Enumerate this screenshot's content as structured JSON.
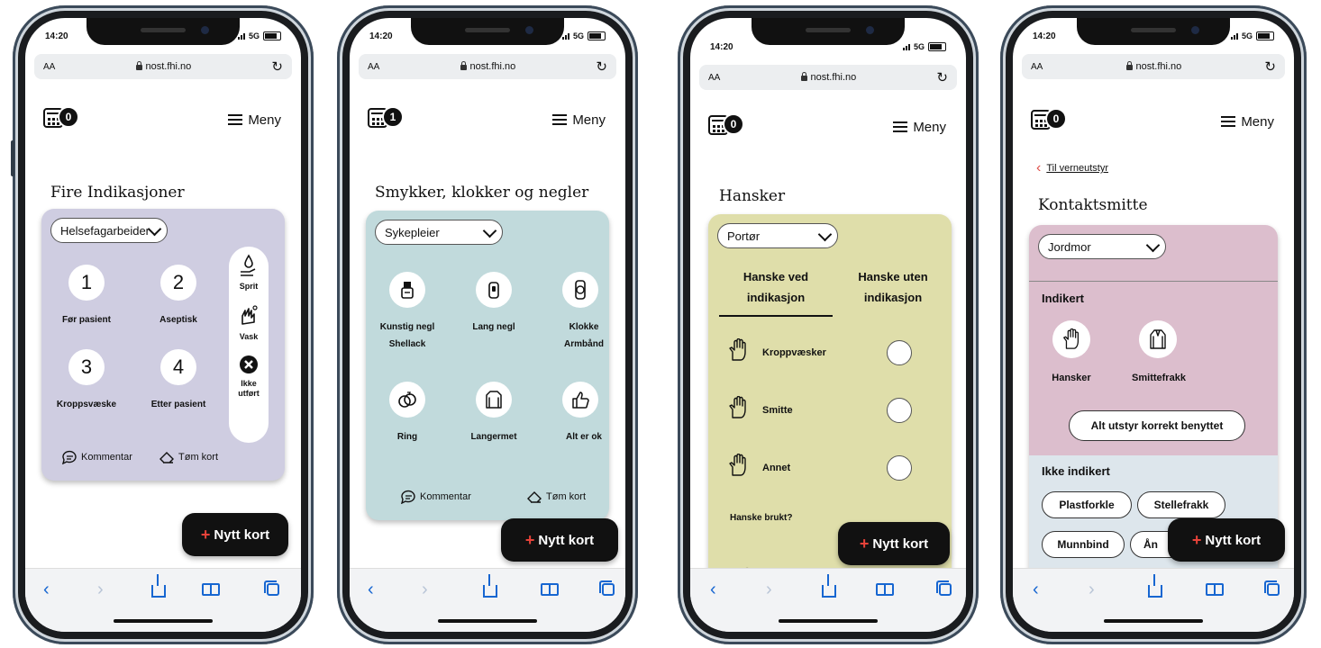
{
  "device": {
    "time": "14:20",
    "network": "5G",
    "aa": "AA",
    "url": "nost.fhi.no"
  },
  "header": {
    "menu_label": "Meny"
  },
  "footer": {
    "comment_label": "Kommentar",
    "clear_label": "Tøm kort"
  },
  "fab": {
    "plus": "+",
    "label": "Nytt kort"
  },
  "screens": [
    {
      "card_count": "0",
      "title": "Fire Indikasjoner",
      "role": "Helsefagarbeider",
      "panel_color": "#cfcde1",
      "indications": [
        {
          "number": "1",
          "label": "Før pasient"
        },
        {
          "number": "2",
          "label": "Aseptisk"
        },
        {
          "number": "3",
          "label": "Kroppsvæske"
        },
        {
          "number": "4",
          "label": "Etter pasient"
        }
      ],
      "actions": [
        {
          "label": "Sprit",
          "icon": "hand-sanitizer-icon"
        },
        {
          "label": "Vask",
          "icon": "hand-wash-icon"
        },
        {
          "label": "Ikke utført",
          "icon": "x-circle-icon"
        }
      ]
    },
    {
      "card_count": "1",
      "title": "Smykker, klokker og negler",
      "role": "Sykepleier",
      "panel_color": "#c1dadc",
      "items": [
        {
          "line1": "Kunstig negl",
          "line2": "Shellack",
          "icon": "nail-polish-icon"
        },
        {
          "line1": "Lang negl",
          "line2": "",
          "icon": "long-nail-icon"
        },
        {
          "line1": "Klokke",
          "line2": "Armbånd",
          "icon": "watch-icon"
        },
        {
          "line1": "Ring",
          "line2": "",
          "icon": "rings-icon"
        },
        {
          "line1": "Langermet",
          "line2": "",
          "icon": "long-sleeve-icon"
        },
        {
          "line1": "Alt er ok",
          "line2": "",
          "icon": "thumbs-up-icon"
        }
      ]
    },
    {
      "card_count": "0",
      "title": "Hansker",
      "role": "Portør",
      "panel_color": "#dfdeaa",
      "tab_active": "Hanske ved indikasjon",
      "tab_inactive": "Hanske uten indikasjon",
      "rows": [
        {
          "label": "Kroppvæsker",
          "icon": "glove-icon"
        },
        {
          "label": "Smitte",
          "icon": "glove-icon"
        },
        {
          "label": "Annet",
          "icon": "glove-icon"
        }
      ],
      "question": "Hanske brukt?"
    },
    {
      "card_count": "0",
      "back_link": "Til verneutstyr",
      "title": "Kontaktsmitte",
      "role": "Jordmor",
      "top_color": "#dcbecd",
      "bottom_color": "#dde6ec",
      "indicated_heading": "Indikert",
      "indicated_items": [
        {
          "label": "Hansker",
          "icon": "glove-icon"
        },
        {
          "label": "Smittefrakk",
          "icon": "gown-icon"
        }
      ],
      "all_correct_label": "Alt utstyr korrekt benyttet",
      "not_indicated_heading": "Ikke indikert",
      "not_indicated_pills": [
        "Plastforkle",
        "Stellefrakk",
        "Munnbind",
        "Ån"
      ]
    }
  ]
}
